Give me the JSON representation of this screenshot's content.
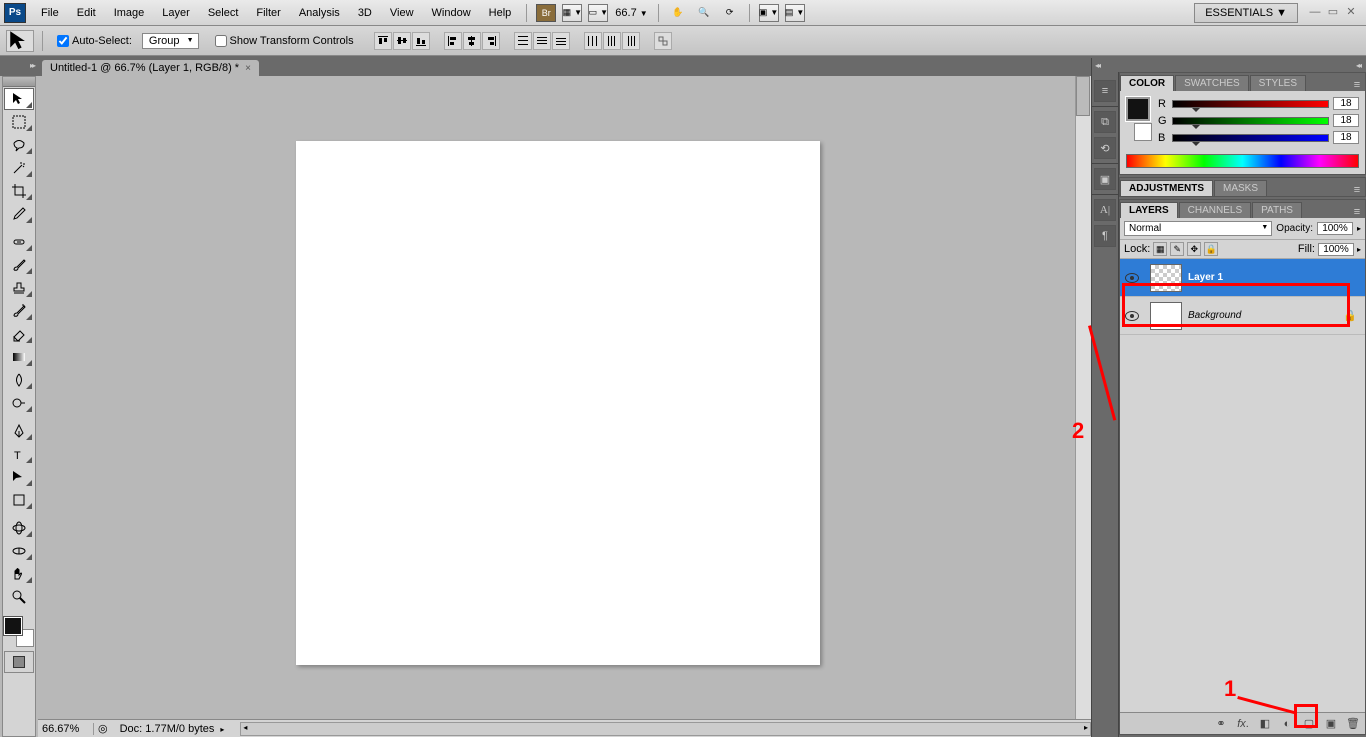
{
  "menu": {
    "items": [
      "File",
      "Edit",
      "Image",
      "Layer",
      "Select",
      "Filter",
      "Analysis",
      "3D",
      "View",
      "Window",
      "Help"
    ],
    "bridge": "Br",
    "zoom": "66.7",
    "workspace": "ESSENTIALS ▼"
  },
  "options": {
    "autoSelectLabel": "Auto-Select:",
    "autoSelectValue": "Group",
    "showTransformLabel": "Show Transform Controls"
  },
  "docTab": "Untitled-1 @ 66.7% (Layer 1, RGB/8) *",
  "statusbar": {
    "zoom": "66.67%",
    "doc": "Doc: 1.77M/0 bytes"
  },
  "colorPanel": {
    "tabs": [
      "COLOR",
      "SWATCHES",
      "STYLES"
    ],
    "r": "18",
    "g": "18",
    "b": "18"
  },
  "adjPanel": {
    "tabs": [
      "ADJUSTMENTS",
      "MASKS"
    ]
  },
  "layersPanel": {
    "tabs": [
      "LAYERS",
      "CHANNELS",
      "PATHS"
    ],
    "blend": "Normal",
    "opacityLabel": "Opacity:",
    "opacity": "100%",
    "lockLabel": "Lock:",
    "fillLabel": "Fill:",
    "fill": "100%",
    "layers": [
      {
        "name": "Layer 1",
        "selected": true,
        "bg": false,
        "checker": true
      },
      {
        "name": "Background",
        "selected": false,
        "bg": true,
        "checker": false
      }
    ]
  },
  "annotations": {
    "label1": "1",
    "label2": "2"
  }
}
